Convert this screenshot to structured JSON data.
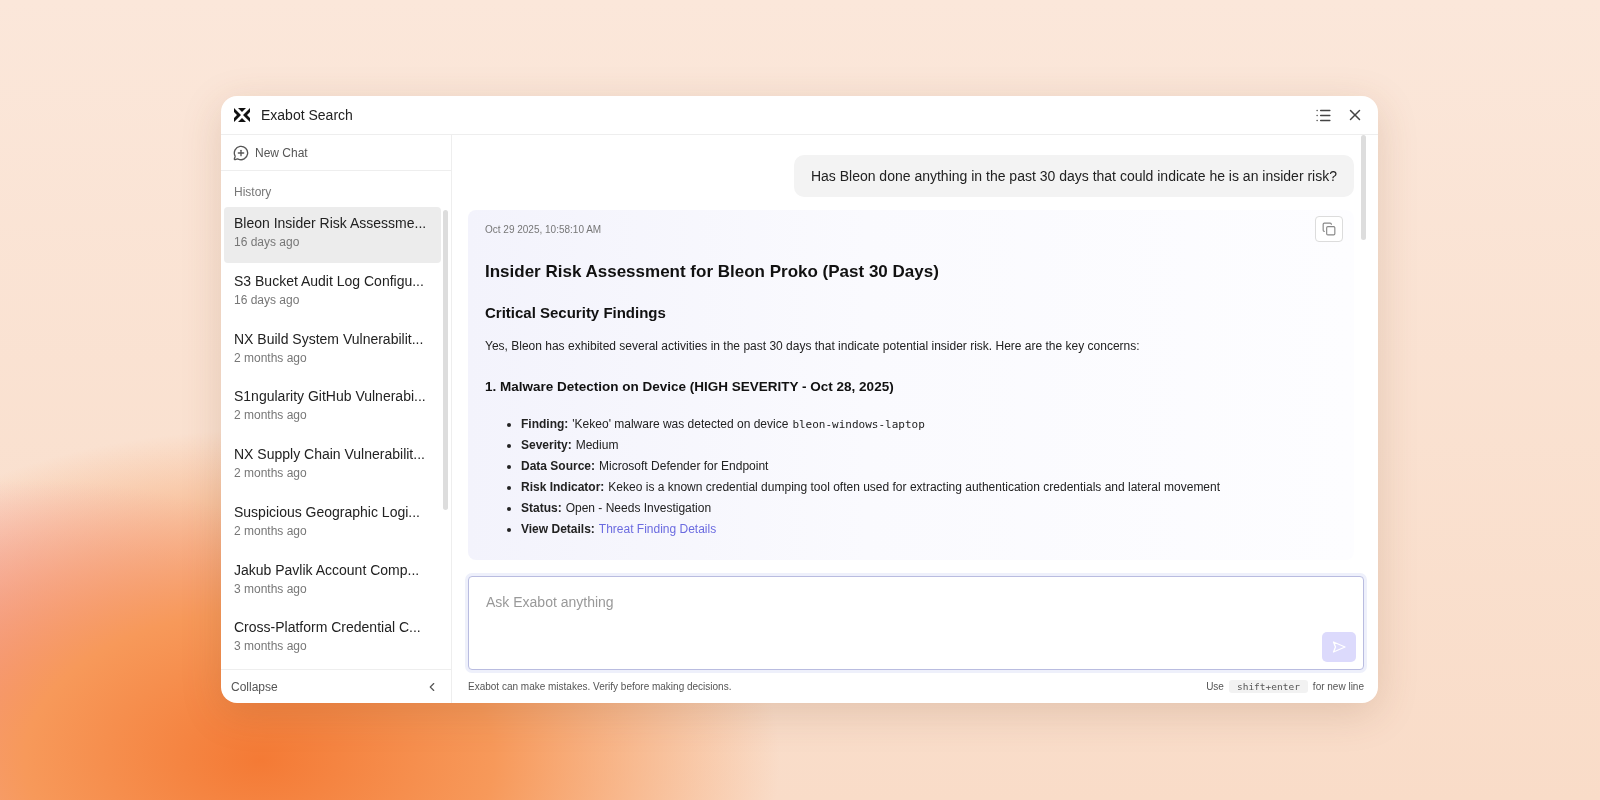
{
  "window": {
    "title": "Exabot Search"
  },
  "sidebar": {
    "new_chat": "New Chat",
    "history_label": "History",
    "collapse": "Collapse",
    "items": [
      {
        "title": "Bleon Insider Risk Assessme...",
        "time": "16 days ago",
        "selected": true
      },
      {
        "title": "S3 Bucket Audit Log Configu...",
        "time": "16 days ago",
        "selected": false
      },
      {
        "title": "NX Build System Vulnerabilit...",
        "time": "2 months ago",
        "selected": false
      },
      {
        "title": "S1ngularity GitHub Vulnerabi...",
        "time": "2 months ago",
        "selected": false
      },
      {
        "title": "NX Supply Chain Vulnerabilit...",
        "time": "2 months ago",
        "selected": false
      },
      {
        "title": "Suspicious Geographic Logi...",
        "time": "2 months ago",
        "selected": false
      },
      {
        "title": "Jakub Pavlik Account Comp...",
        "time": "3 months ago",
        "selected": false
      },
      {
        "title": "Cross-Platform Credential C...",
        "time": "3 months ago",
        "selected": false
      }
    ]
  },
  "chat": {
    "user_message": "Has Bleon done anything in the past 30 days that could indicate he is an insider risk?",
    "response": {
      "timestamp": "Oct 29 2025, 10:58:10 AM",
      "title": "Insider Risk Assessment for Bleon Proko (Past 30 Days)",
      "section_heading": "Critical Security Findings",
      "intro": "Yes, Bleon has exhibited several activities in the past 30 days that indicate potential insider risk. Here are the key concerns:",
      "finding_heading": "1. Malware Detection on Device (HIGH SEVERITY - Oct 28, 2025)",
      "bullets": [
        {
          "label": "Finding:",
          "text": "'Kekeo' malware was detected on device",
          "code": "bleon-windows-laptop"
        },
        {
          "label": "Severity:",
          "text": "Medium"
        },
        {
          "label": "Data Source:",
          "text": "Microsoft Defender for Endpoint"
        },
        {
          "label": "Risk Indicator:",
          "text": "Kekeo is a known credential dumping tool often used for extracting authentication credentials and lateral movement"
        },
        {
          "label": "Status:",
          "text": "Open - Needs Investigation"
        },
        {
          "label": "View Details:",
          "link": "Threat Finding Details"
        }
      ]
    }
  },
  "composer": {
    "placeholder": "Ask Exabot anything",
    "send_disabled": true
  },
  "footer": {
    "disclaimer": "Exabot can make mistakes. Verify before making decisions.",
    "hint_before": "Use",
    "hint_key": "shift+enter",
    "hint_after": "for new line"
  }
}
